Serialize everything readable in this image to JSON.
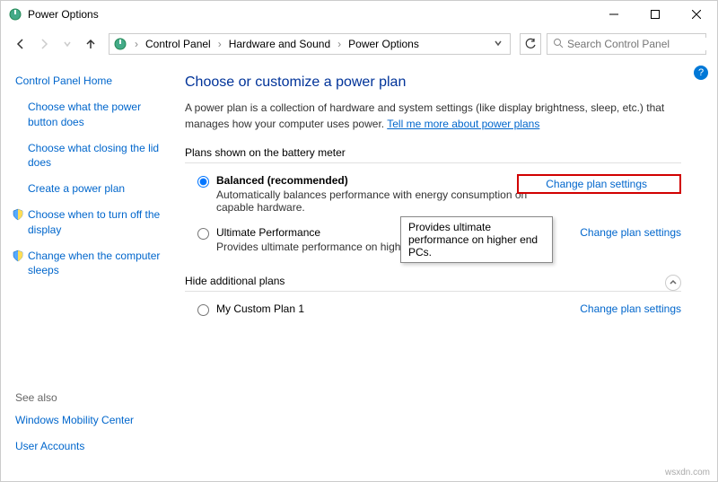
{
  "window": {
    "title": "Power Options"
  },
  "breadcrumb": {
    "items": [
      "Control Panel",
      "Hardware and Sound",
      "Power Options"
    ]
  },
  "search": {
    "placeholder": "Search Control Panel"
  },
  "sidebar": {
    "home": "Control Panel Home",
    "links": [
      "Choose what the power button does",
      "Choose what closing the lid does",
      "Create a power plan",
      "Choose when to turn off the display",
      "Change when the computer sleeps"
    ],
    "see_also_label": "See also",
    "see_also_links": [
      "Windows Mobility Center",
      "User Accounts"
    ]
  },
  "main": {
    "heading": "Choose or customize a power plan",
    "description": "A power plan is a collection of hardware and system settings (like display brightness, sleep, etc.) that manages how your computer uses power. ",
    "more_link": "Tell me more about power plans",
    "section1_label": "Plans shown on the battery meter",
    "plans": [
      {
        "name": "Balanced (recommended)",
        "desc": "Automatically balances performance with energy consumption on capable hardware.",
        "selected": true,
        "change": "Change plan settings"
      },
      {
        "name": "Ultimate Performance",
        "desc": "Provides ultimate performance on higher en",
        "selected": false,
        "change": "Change plan settings"
      }
    ],
    "hide_label": "Hide additional plans",
    "additional_plans": [
      {
        "name": "My Custom Plan 1",
        "selected": false,
        "change": "Change plan settings"
      }
    ]
  },
  "tooltip": {
    "text": "Provides ultimate performance on higher end PCs."
  },
  "watermark": "wsxdn.com"
}
